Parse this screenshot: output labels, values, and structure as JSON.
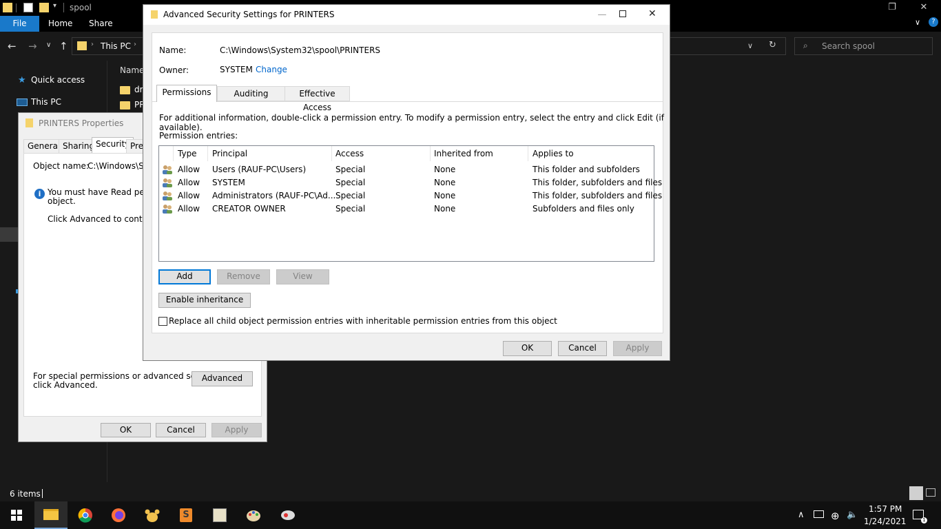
{
  "explorer": {
    "title": "spool",
    "ribbon_tabs": [
      "File",
      "Home",
      "Share"
    ],
    "address": "This PC",
    "search_placeholder": "Search spool",
    "nav_items": [
      "Quick access",
      "This PC"
    ],
    "column_header": "Name",
    "files": [
      "dr",
      "PR"
    ],
    "status": "6 items"
  },
  "properties": {
    "title": "PRINTERS Properties",
    "tabs": [
      "General",
      "Sharing",
      "Security",
      "Prev"
    ],
    "object_name_label": "Object name:",
    "object_name_value": "C:\\Windows\\Sys",
    "info_line1": "You must have Read permiss",
    "info_line2": "object.",
    "continue_text": "Click Advanced to continue.",
    "special_line1": "For special permissions or advanced settings,",
    "special_line2": "click Advanced.",
    "advanced_button": "Advanced",
    "ok": "OK",
    "cancel": "Cancel",
    "apply": "Apply"
  },
  "advanced": {
    "title": "Advanced Security Settings for PRINTERS",
    "name_label": "Name:",
    "name_value": "C:\\Windows\\System32\\spool\\PRINTERS",
    "owner_label": "Owner:",
    "owner_value": "SYSTEM",
    "change_link": "Change",
    "tabs": [
      "Permissions",
      "Auditing",
      "Effective Access"
    ],
    "info_text": "For additional information, double-click a permission entry. To modify a permission entry, select the entry and click Edit (if available).",
    "entries_label": "Permission entries:",
    "columns": [
      "Type",
      "Principal",
      "Access",
      "Inherited from",
      "Applies to"
    ],
    "rows": [
      [
        "Allow",
        "Users (RAUF-PC\\Users)",
        "Special",
        "None",
        "This folder and subfolders"
      ],
      [
        "Allow",
        "SYSTEM",
        "Special",
        "None",
        "This folder, subfolders and files"
      ],
      [
        "Allow",
        "Administrators (RAUF-PC\\Ad...",
        "Special",
        "None",
        "This folder, subfolders and files"
      ],
      [
        "Allow",
        "CREATOR OWNER",
        "Special",
        "None",
        "Subfolders and files only"
      ]
    ],
    "add": "Add",
    "remove": "Remove",
    "view": "View",
    "enable_inheritance": "Enable inheritance",
    "replace_checkbox": "Replace all child object permission entries with inheritable permission entries from this object",
    "ok": "OK",
    "cancel": "Cancel",
    "apply": "Apply"
  },
  "taskbar": {
    "time": "1:57 PM",
    "date": "1/24/2021"
  },
  "colors": {
    "accent": "#0078d7",
    "file_tab": "#1979ca",
    "link": "#0066cc",
    "folder": "#f5d36b"
  }
}
